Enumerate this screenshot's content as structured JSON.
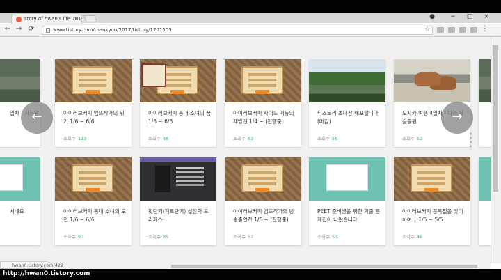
{
  "browser": {
    "tab_title": "story of hwan's life 201",
    "tab_close": "×",
    "url": "www.tistory.com/thankyou/2017/tistory/1701503",
    "back": "←",
    "forward": "→",
    "reload": "⟳",
    "star": "☆",
    "menu": "⋮",
    "win_user": "●",
    "win_min": "−",
    "win_max": "□",
    "win_close": "×",
    "status_url": "hwan0.tistory.com/422"
  },
  "carousel": {
    "prev": "←",
    "next": "→",
    "views_label": "조회수",
    "row1": [
      {
        "title": "일차 - 사천왕",
        "views": "",
        "thumb": "photo-pond"
      },
      {
        "title": "아이러브커피 엠뜨작가의 위기 1/6 ~ 6/6",
        "views": "113",
        "thumb": "game"
      },
      {
        "title": "아이러브커피 홍대 소녀의 꿈 1/6 ~ 6/6",
        "views": "88",
        "thumb": "game-notebook"
      },
      {
        "title": "아이러브커피 사이드 메뉴의 재발견 1/4 ~ (진행중)",
        "views": "63",
        "thumb": "game"
      },
      {
        "title": "티스토리 초대장 배포합니다(마감)",
        "views": "56",
        "thumb": "photo-garden"
      },
      {
        "title": "오사카 여행 4일차 - 나라 사슴공원",
        "views": "52",
        "thumb": "photo-deer"
      }
    ],
    "row2": [
      {
        "title": "시네요",
        "views": "",
        "thumb": "tistory"
      },
      {
        "title": "아이러브커피 홍대 소녀의 도전 1/6 ~ 6/6",
        "views": "93",
        "thumb": "game"
      },
      {
        "title": "핏단기(피트단기) 실전력 프리패스",
        "views": "85",
        "thumb": "dark"
      },
      {
        "title": "아이러브커피 엠뜨작가의 방송출연?! 1/6 ~ (진행중)",
        "views": "57",
        "thumb": "game"
      },
      {
        "title": "PEET 준비생을 위한 기출 문제집이 나왔습니다",
        "views": "53",
        "thumb": "tistory"
      },
      {
        "title": "아이러브커피 공복절을 맞이하여... 1/5 ~ 5/5",
        "views": "46",
        "thumb": "game"
      }
    ]
  },
  "watermark": "http://hwan0.tistory.com"
}
